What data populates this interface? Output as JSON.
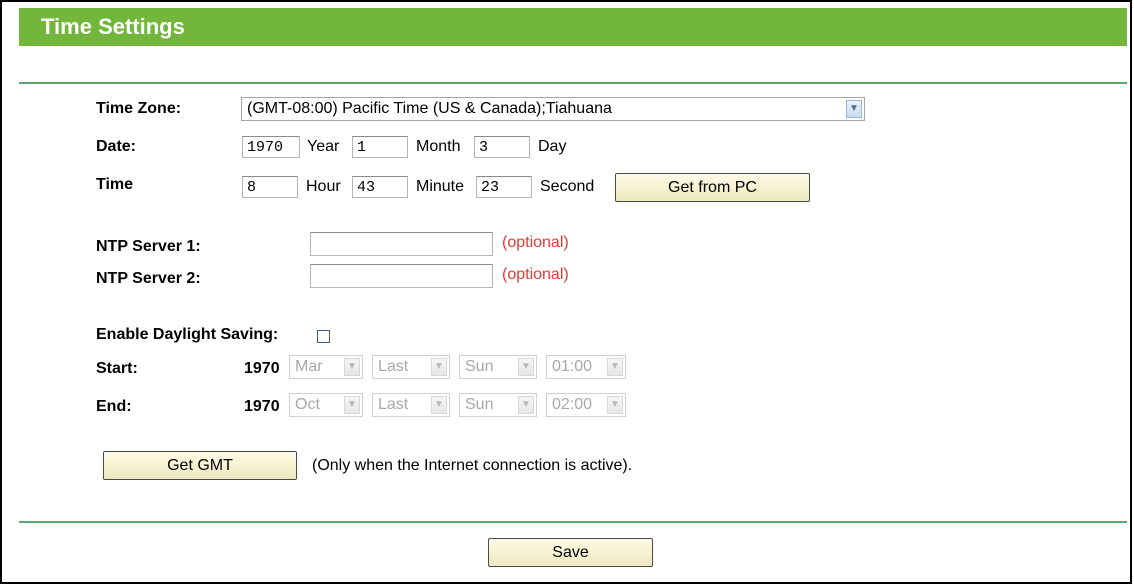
{
  "header": {
    "title": "Time Settings"
  },
  "time_zone": {
    "label": "Time Zone:",
    "value": "(GMT-08:00) Pacific Time (US & Canada);Tiahuana",
    "icon": "chevron-down-icon"
  },
  "date": {
    "label": "Date:",
    "year_value": "1970",
    "year_label": "Year",
    "month_value": "1",
    "month_label": "Month",
    "day_value": "3",
    "day_label": "Day"
  },
  "time": {
    "label": "Time",
    "hour_value": "8",
    "hour_label": "Hour",
    "minute_value": "43",
    "minute_label": "Minute",
    "second_value": "23",
    "second_label": "Second",
    "get_from_pc_label": "Get from PC"
  },
  "ntp": {
    "server1_label": "NTP Server 1:",
    "server1_value": "",
    "server1_hint": "(optional)",
    "server2_label": "NTP Server 2:",
    "server2_value": "",
    "server2_hint": "(optional)"
  },
  "daylight": {
    "label": "Enable Daylight Saving:",
    "checked": false,
    "start": {
      "label": "Start:",
      "year": "1970",
      "month": "Mar",
      "week": "Last",
      "day": "Sun",
      "time": "01:00"
    },
    "end": {
      "label": "End:",
      "year": "1970",
      "month": "Oct",
      "week": "Last",
      "day": "Sun",
      "time": "02:00"
    }
  },
  "gmt": {
    "button_label": "Get GMT",
    "note": "(Only when the Internet connection is active)."
  },
  "save_label": "Save",
  "colors": {
    "header_bg": "#73b63c",
    "rule": "#5ea672",
    "optional": "#e03c31",
    "button_bg": "#f5f1d4"
  }
}
